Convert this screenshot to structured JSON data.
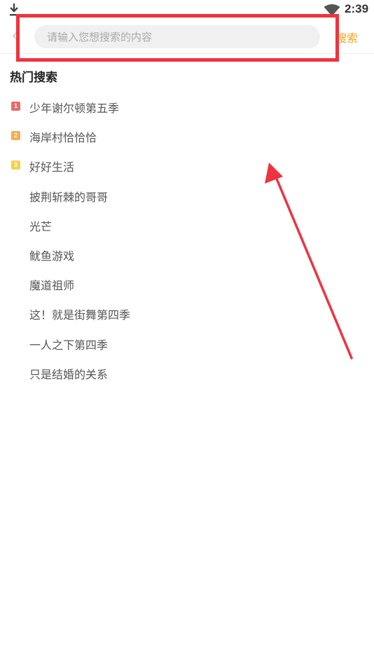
{
  "status_bar": {
    "time": "2:39",
    "download_icon": "download-icon",
    "wifi_icon": "wifi-icon"
  },
  "header": {
    "back_icon": "back-arrow-icon",
    "search_placeholder": "请输入您想搜索的内容",
    "search_value": "",
    "search_button_label": "搜索"
  },
  "hot_search": {
    "title": "热门搜索",
    "items": [
      {
        "rank": "1",
        "label": "少年谢尔顿第五季",
        "badge_color": "#e86b6b"
      },
      {
        "rank": "2",
        "label": "海岸村恰恰恰",
        "badge_color": "#f0b050"
      },
      {
        "rank": "3",
        "label": "好好生活",
        "badge_color": "#f3d248"
      },
      {
        "rank": "",
        "label": "披荆斩棘的哥哥",
        "badge_color": ""
      },
      {
        "rank": "",
        "label": "光芒",
        "badge_color": ""
      },
      {
        "rank": "",
        "label": "鱿鱼游戏",
        "badge_color": ""
      },
      {
        "rank": "",
        "label": "魔道祖师",
        "badge_color": ""
      },
      {
        "rank": "",
        "label": "这！就是街舞第四季",
        "badge_color": ""
      },
      {
        "rank": "",
        "label": "一人之下第四季",
        "badge_color": ""
      },
      {
        "rank": "",
        "label": "只是结婚的关系",
        "badge_color": ""
      }
    ]
  },
  "annotation": {
    "color": "#ee3440"
  },
  "colors": {
    "accent": "#f5a623",
    "search_bg": "#f0f0f0"
  }
}
